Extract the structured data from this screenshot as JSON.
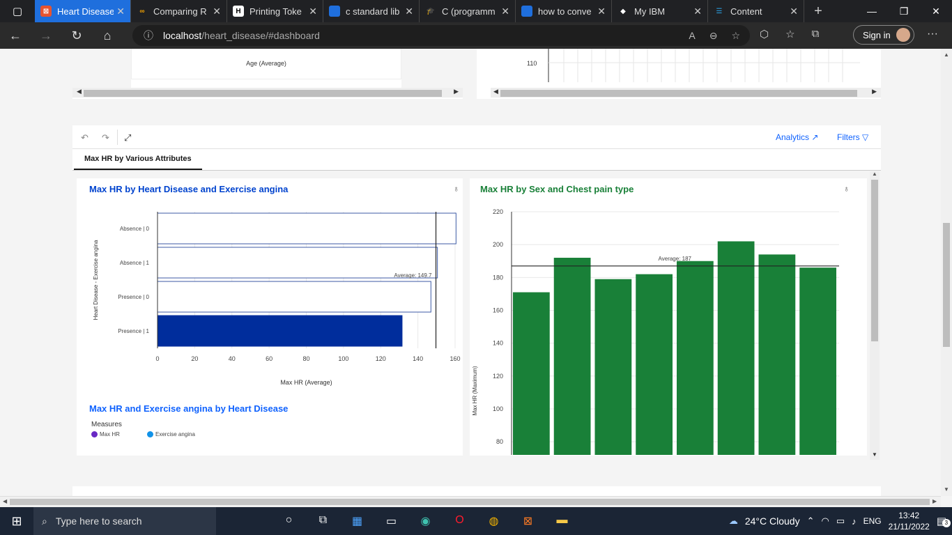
{
  "browser": {
    "tabs": [
      {
        "title": "Heart Disease",
        "active": true
      },
      {
        "title": "Comparing R",
        "active": false
      },
      {
        "title": "Printing Toke",
        "active": false
      },
      {
        "title": "c standard lib",
        "active": false
      },
      {
        "title": "C (programm",
        "active": false
      },
      {
        "title": "how to conve",
        "active": false
      },
      {
        "title": "My IBM",
        "active": false
      },
      {
        "title": "Content",
        "active": false
      }
    ],
    "url_host": "localhost",
    "url_path": "/heart_disease/#dashboard",
    "signin_label": "Sign in"
  },
  "top_panels": {
    "left_axis_label": "Age (Average)",
    "right_tick": "110"
  },
  "toolbar": {
    "analytics_label": "Analytics",
    "filters_label": "Filters"
  },
  "tab": {
    "label": "Max HR by Various Attributes"
  },
  "chart1": {
    "title": "Max HR by Heart Disease and Exercise angina",
    "xlabel": "Max HR (Average)",
    "ylabel": "Heart Disease - Exercise angina",
    "avg_label": "Average: 149.7"
  },
  "chart2": {
    "title": "Max HR by Sex and Chest pain type",
    "ylabel": "Max HR (Maximum)",
    "avg_label": "Average: 187"
  },
  "chart3": {
    "title": "Max HR and Exercise angina by Heart Disease",
    "legend_title": "Measures",
    "legend_items": [
      "Max HR",
      "Exercise angina"
    ]
  },
  "taskbar": {
    "search_placeholder": "Type here to search",
    "weather": "24°C  Cloudy",
    "lang": "ENG",
    "time": "13:42",
    "date": "21/11/2022",
    "notif_count": "3"
  },
  "colors": {
    "blue_bar": "#002d9c",
    "green_bar": "#198038",
    "title_blue": "#0043ce",
    "title_green": "#198038"
  },
  "chart_data": [
    {
      "type": "bar",
      "orientation": "horizontal",
      "title": "Max HR by Heart Disease and Exercise angina",
      "xlabel": "Max HR (Average)",
      "ylabel": "Heart Disease - Exercise angina",
      "categories": [
        "Absence | 0",
        "Absence | 1",
        "Presence | 0",
        "Presence | 1"
      ],
      "values": [
        160.5,
        150.5,
        147,
        131.5
      ],
      "average": 149.7,
      "xlim": [
        0,
        160
      ],
      "xticks": [
        0,
        20,
        40,
        60,
        80,
        100,
        120,
        140,
        160
      ],
      "highlighted": "Presence | 1"
    },
    {
      "type": "bar",
      "title": "Max HR by Sex and Chest pain type",
      "ylabel": "Max HR (Maximum)",
      "values": [
        171,
        192,
        179,
        182,
        190,
        202,
        194,
        186
      ],
      "average": 187,
      "ylim": [
        72,
        220
      ],
      "yticks": [
        80,
        100,
        120,
        140,
        160,
        180,
        200,
        220
      ]
    }
  ]
}
